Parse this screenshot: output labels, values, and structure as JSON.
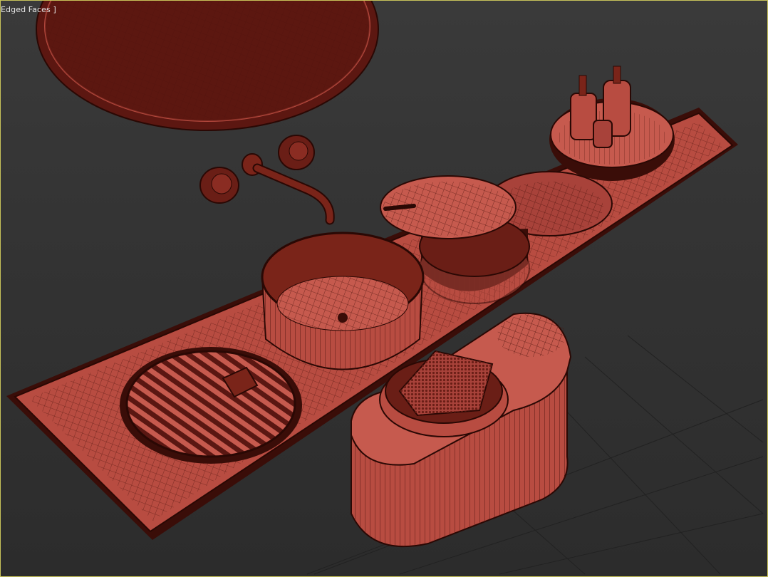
{
  "viewport": {
    "label": "Edged Faces ]",
    "border_color": "#c8c35a",
    "background": "#333333"
  },
  "scene": {
    "objects": [
      "round-mirror",
      "wall-faucet-spout",
      "faucet-handle-left",
      "faucet-handle-right",
      "vanity-countertop-tray",
      "vessel-sink-bowl",
      "lidded-round-container",
      "round-tray-with-soap-bottles",
      "soap-dispenser-bottles",
      "slatted-round-dish",
      "soap-bar",
      "oval-storage-basket",
      "folded-towel",
      "floor-grid"
    ],
    "material_color": "#c65a4e",
    "edge_color": "#3a0d08"
  }
}
